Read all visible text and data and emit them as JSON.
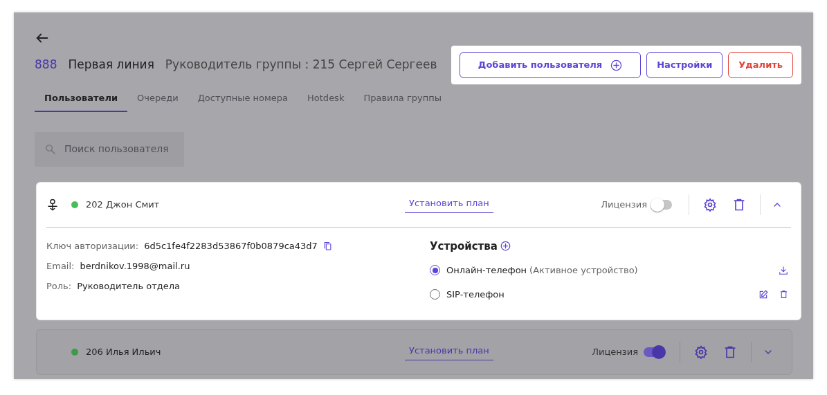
{
  "header": {
    "number": "888",
    "name": "Первая линия",
    "leader": "Руководитель группы : 215 Сергей Сергеев"
  },
  "header_actions": {
    "highlighted": true,
    "buttons": [
      {
        "label": "Добавить пользователя",
        "kind": "add"
      },
      {
        "label": "Настройки",
        "kind": "primary"
      },
      {
        "label": "Удалить",
        "kind": "danger"
      }
    ]
  },
  "tabs": [
    {
      "label": "Пользователи",
      "selected": true
    },
    {
      "label": "Очереди",
      "selected": false
    },
    {
      "label": "Доступные номера",
      "selected": false
    },
    {
      "label": "Hotdesk",
      "selected": false
    },
    {
      "label": "Правила группы",
      "selected": false
    }
  ],
  "search": {
    "placeholder": "Поиск пользователя"
  },
  "users": [
    {
      "name": "202 Джон Смит",
      "highlighted": true,
      "leader": true,
      "color": "#4cbb5a",
      "plan_link": "Установить план",
      "license_label": "Лицензия",
      "license_on": false,
      "expanded": true,
      "details": [
        {
          "label": "Ключ авторизации:",
          "value": "6d5c1fe4f2283d53867f0b0879ca43d7",
          "copyable": true
        },
        {
          "label": "Email:",
          "value": "berdnikov.1998@mail.ru",
          "copyable": false
        },
        {
          "label": "Роль:",
          "value": "Руководитель отдела",
          "copyable": false
        }
      ],
      "devices_title": "Устройства",
      "devices": [
        {
          "name": "Онлайн-телефон",
          "note": "(Активное устройство)",
          "selected": true,
          "kind": "online"
        },
        {
          "name": "SIP-телефон",
          "selected": false,
          "kind": "sip"
        }
      ]
    },
    {
      "name": "206 Илья Ильич",
      "highlighted": false,
      "leader": false,
      "color": "#3f9a48",
      "plan_link": "Установить план",
      "license_label": "Лицензия",
      "license_on": true,
      "expanded": false
    }
  ]
}
